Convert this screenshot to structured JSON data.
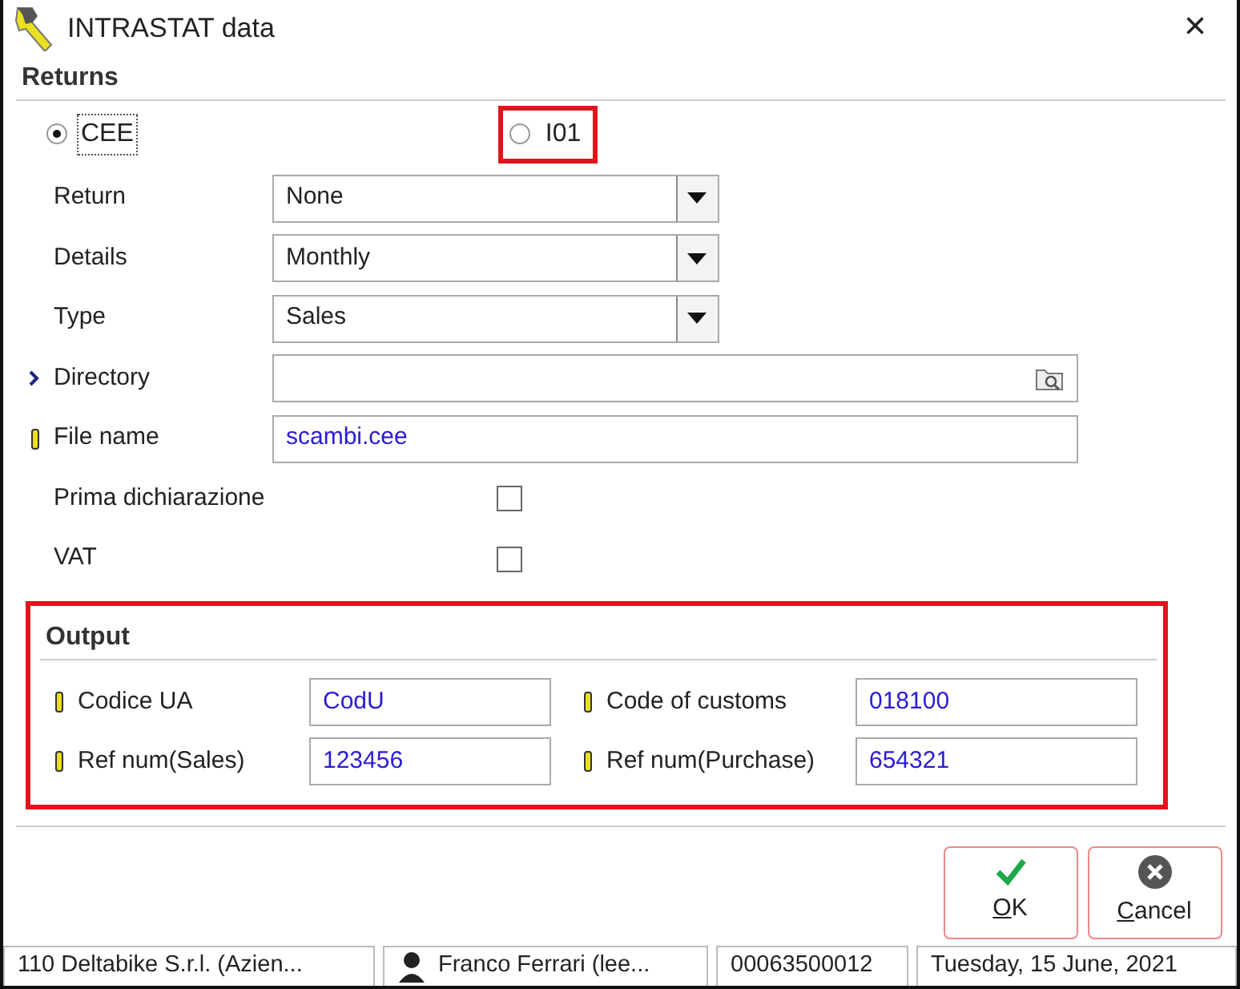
{
  "window": {
    "title": "INTRASTAT data",
    "close": "×"
  },
  "returns": {
    "heading": "Returns",
    "options": [
      {
        "label": "CEE",
        "selected": true,
        "focused": true,
        "highlighted": false
      },
      {
        "label": "I01",
        "selected": false,
        "focused": false,
        "highlighted": true
      }
    ],
    "fields": [
      {
        "label": "Return",
        "kind": "combo",
        "value": "None"
      },
      {
        "label": "Details",
        "kind": "combo",
        "value": "Monthly"
      },
      {
        "label": "Type",
        "kind": "combo",
        "value": "Sales"
      },
      {
        "label": "Directory",
        "kind": "browse",
        "linked": true
      },
      {
        "label": "File name",
        "kind": "text",
        "value": "scambi.cee",
        "required": true
      },
      {
        "label": "Prima dichiarazione",
        "kind": "checkbox",
        "checked": false
      },
      {
        "label": "VAT",
        "kind": "checkbox",
        "checked": false
      }
    ]
  },
  "output": {
    "heading": "Output",
    "highlighted": true,
    "fields": [
      {
        "label": "Codice UA",
        "value": "CodU",
        "required": true
      },
      {
        "label": "Code of customs",
        "value": "018100",
        "required": true
      },
      {
        "label": "Ref num(Sales)",
        "value": "123456",
        "required": true
      },
      {
        "label": "Ref num(Purchase)",
        "value": "654321",
        "required": true
      }
    ]
  },
  "buttons": [
    {
      "label": "OK",
      "kind": "confirm",
      "mnemonic": true,
      "highlighted": true
    },
    {
      "label": "Cancel",
      "kind": "cancel",
      "mnemonic": true,
      "highlighted": true
    }
  ],
  "status_bar": [
    {
      "kind": "text",
      "text": "110 Deltabike S.r.l. (Azien..."
    },
    {
      "kind": "user",
      "text": "Franco Ferrari (lee..."
    },
    {
      "kind": "text",
      "text": "00063500012"
    },
    {
      "kind": "text",
      "text": "Tuesday, 15 June, 2021"
    }
  ]
}
